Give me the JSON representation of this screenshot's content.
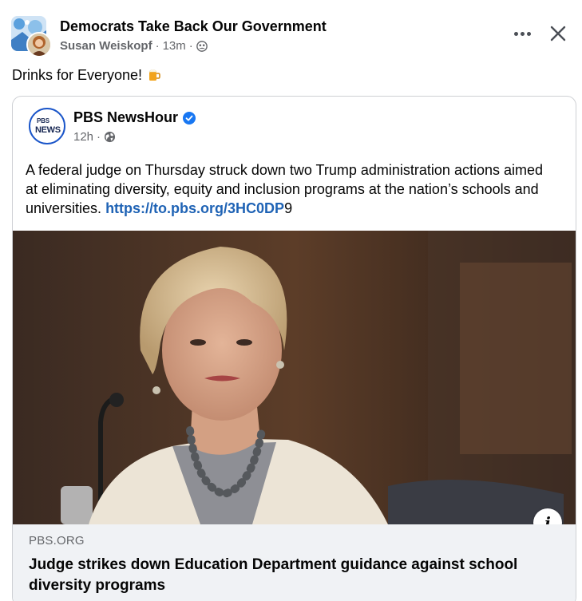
{
  "post": {
    "group_name": "Democrats Take Back Our Government",
    "author": "Susan Weiskopf",
    "time": "13m",
    "separator": "·",
    "text": "Drinks for Everyone!"
  },
  "shared": {
    "page_name": "PBS NewsHour",
    "logo_line1": "PBS",
    "logo_line2": "NEWS",
    "time": "12h",
    "separator": "·",
    "text": "A federal judge on Thursday struck down two Trump administration actions aimed at eliminating diversity, equity and inclusion programs at the nation’s schools and universities.",
    "link": "https://to.pbs.org/3HC0DP",
    "link_suffix": "9"
  },
  "link_preview": {
    "domain": "PBS.ORG",
    "headline": "Judge strikes down Education Department guidance against school diversity programs"
  },
  "icons": {
    "more": "more-options-icon",
    "close": "close-icon",
    "privacy": "group-privacy-icon",
    "verified": "verified-badge-icon",
    "globe": "globe-icon",
    "beer": "beer-mug-emoji",
    "info": "info-icon"
  },
  "colors": {
    "link": "#1f63b5",
    "verified": "#1877f2",
    "secondary_text": "#65676b",
    "footer_bg": "#f0f2f5"
  }
}
